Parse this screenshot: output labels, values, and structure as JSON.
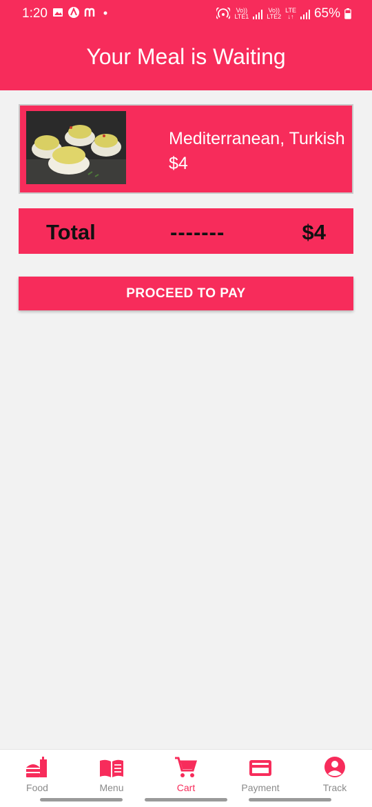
{
  "status_bar": {
    "time": "1:20",
    "sim1_label_top": "Vo))",
    "sim1_label_bottom": "LTE1",
    "sim2_label_top": "Vo))",
    "sim2_label_bottom": "LTE2",
    "network_label_top": "LTE",
    "network_label_bottom": "↓↑",
    "battery": "65%"
  },
  "header": {
    "title": "Your Meal is Waiting"
  },
  "cart_items": [
    {
      "name": "Mediterranean, Turkish",
      "price": "$4",
      "image_icon": "deviled-eggs-photo"
    }
  ],
  "total": {
    "label": "Total",
    "separator": "-------",
    "value": "$4"
  },
  "actions": {
    "pay_label": "PROCEED TO PAY"
  },
  "bottom_nav": {
    "items": [
      {
        "label": "Food",
        "icon": "fastfood-icon",
        "active": false
      },
      {
        "label": "Menu",
        "icon": "menu-book-icon",
        "active": false
      },
      {
        "label": "Cart",
        "icon": "cart-icon",
        "active": true
      },
      {
        "label": "Payment",
        "icon": "credit-card-icon",
        "active": false
      },
      {
        "label": "Track",
        "icon": "account-circle-icon",
        "active": false
      }
    ]
  },
  "colors": {
    "accent": "#f72c5b",
    "background": "#f2f2f2",
    "nav_inactive": "#8a8a8a"
  }
}
